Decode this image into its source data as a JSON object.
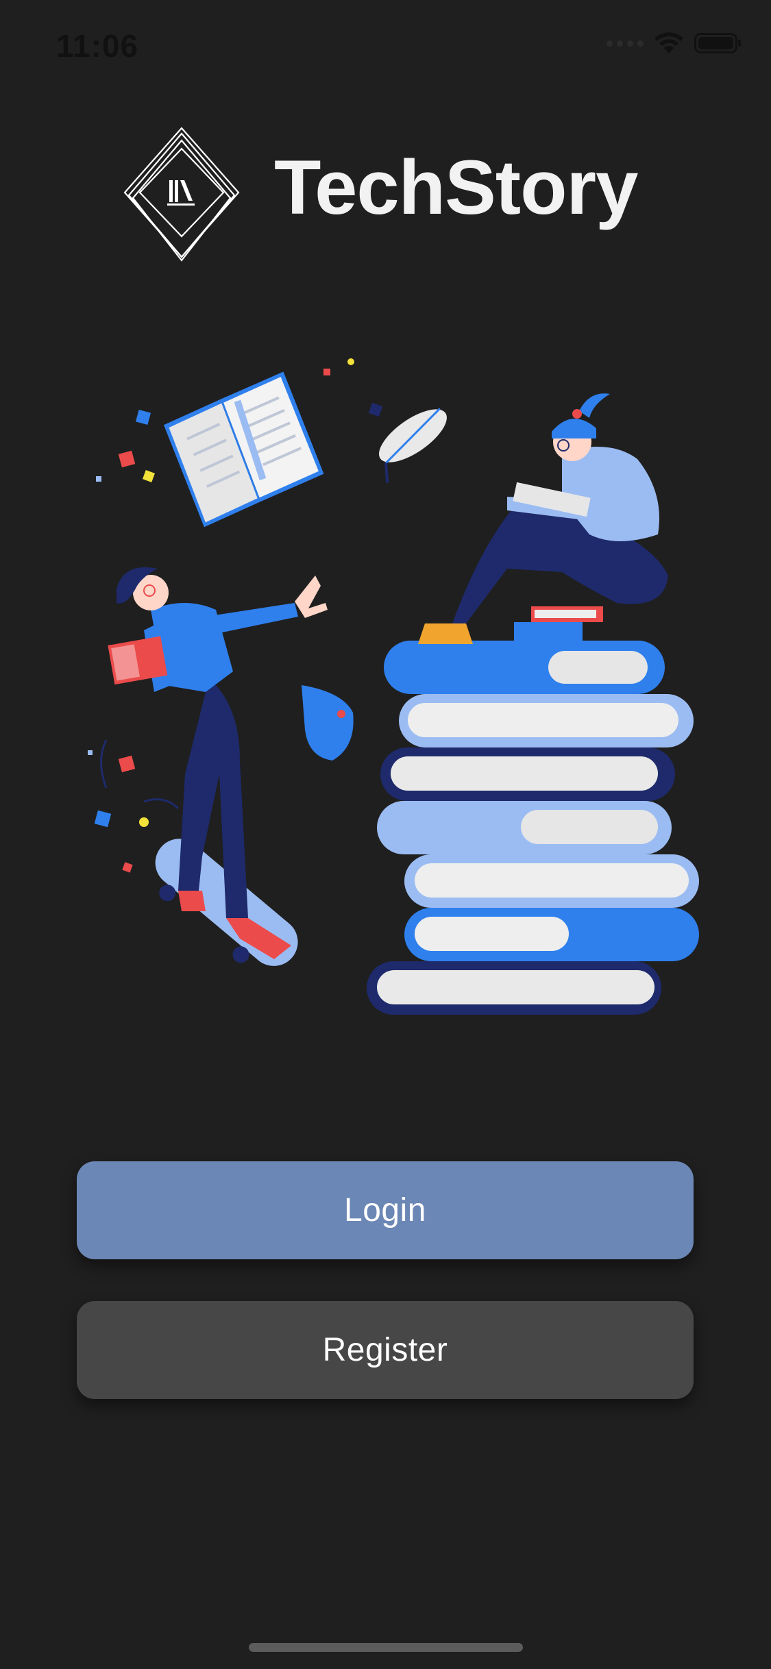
{
  "status_bar": {
    "time": "11:06"
  },
  "app": {
    "title": "TechStory"
  },
  "actions": {
    "login_label": "Login",
    "register_label": "Register"
  },
  "colors": {
    "background": "#1f1f1f",
    "login_button": "#6b87b5",
    "register_button": "#474747",
    "accent_blue": "#2f80ed"
  },
  "icons": {
    "logo": "books-diamond-logo",
    "wifi": "wifi-icon",
    "battery": "battery-icon",
    "signal": "cellular-signal-icon"
  }
}
